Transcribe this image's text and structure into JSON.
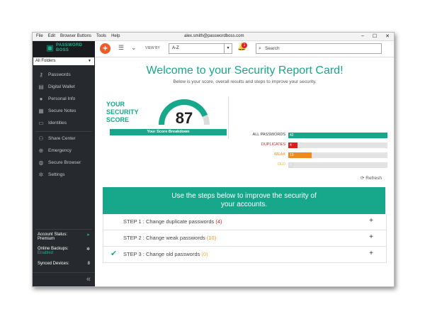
{
  "menubar": {
    "items": [
      "File",
      "Edit",
      "Browser Buttons",
      "Tools",
      "Help"
    ],
    "user": "alex.smith@passwordboss.com",
    "window_controls": [
      "–",
      "☐",
      "✕"
    ]
  },
  "sidebar": {
    "logo_line1": "PASSWORD",
    "logo_line2": "BOSS",
    "folder": "All Folders",
    "items": [
      {
        "label": "Passwords",
        "icon": "key-icon"
      },
      {
        "label": "Digital Wallet",
        "icon": "wallet-icon"
      },
      {
        "label": "Personal Info",
        "icon": "person-icon"
      },
      {
        "label": "Secure Notes",
        "icon": "note-icon"
      },
      {
        "label": "Identities",
        "icon": "id-card-icon"
      },
      {
        "label": "Share Center",
        "icon": "share-icon"
      },
      {
        "label": "Emergency",
        "icon": "lifebuoy-icon"
      },
      {
        "label": "Secure Browser",
        "icon": "globe-icon"
      },
      {
        "label": "Settings",
        "icon": "gear-icon"
      }
    ],
    "account_status_label": "Account Status:",
    "account_status_value": "Premium",
    "backups_label": "Online Backups:",
    "backups_value": "Enabled",
    "synced_label": "Synced Devices:",
    "synced_value": "8",
    "collapse_glyph": "«"
  },
  "toolbar": {
    "view_by_label": "VIEW BY",
    "sort_value": "A-Z",
    "notification_count": "1",
    "search_placeholder": "Search"
  },
  "main": {
    "title": "Welcome to your Security Report Card!",
    "subtitle": "Below is your score, overall results and steps to improve your security.",
    "score_label_line1": "YOUR",
    "score_label_line2": "SECURITY",
    "score_label_line3": "SCORE",
    "score": "87",
    "score_fraction": 0.87,
    "breakdown_label": "Your Score Breakdown",
    "password_stats": [
      {
        "label": "ALL PASSWORDS",
        "count": "42",
        "fraction": 1.0,
        "color": "#17a88c",
        "label_color": "#333333"
      },
      {
        "label": "DUPLICATES",
        "count": "4",
        "fraction": 0.095,
        "color": "#d61f1f",
        "label_color": "#d61f1f"
      },
      {
        "label": "WEAK",
        "count": "10",
        "fraction": 0.238,
        "color": "#f28a1b",
        "label_color": "#f28a1b"
      },
      {
        "label": "OLD",
        "count": "0",
        "fraction": 0.0,
        "color": "#f2c94c",
        "label_color": "#f2b233"
      }
    ],
    "refresh_label": "Refresh",
    "banner_line1": "Use the steps below to improve the security of",
    "banner_line2": "your accounts.",
    "steps": [
      {
        "text": "STEP 1 : Change duplicate passwords",
        "count": "(4)",
        "count_color": "#d61f1f",
        "done": false
      },
      {
        "text": "STEP 2 : Change weak passwords",
        "count": "(10)",
        "count_color": "#f28a1b",
        "done": false
      },
      {
        "text": "STEP 3 : Change old passwords",
        "count": "(0)",
        "count_color": "#f2b233",
        "done": true
      }
    ],
    "accent_color": "#17a88c"
  }
}
